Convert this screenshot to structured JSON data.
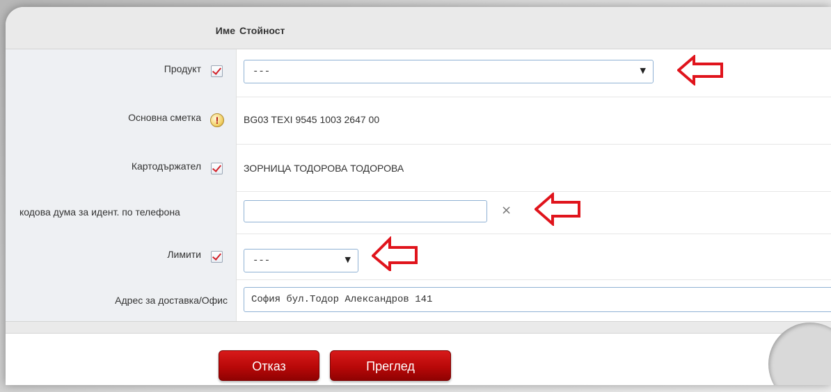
{
  "table": {
    "header_name": "Име",
    "header_value": "Стойност"
  },
  "rows": {
    "product": {
      "label": "Продукт",
      "selected": "---"
    },
    "main_account": {
      "label": "Основна сметка",
      "warn_glyph": "!",
      "value": "BG03 TEXI 9545 1003 2647 00"
    },
    "cardholder": {
      "label": "Картодържател",
      "value": "ЗОРНИЦА ТОДОРОВА ТОДОРОВА"
    },
    "code_word": {
      "label": "кодова дума за идент. по телефона",
      "value": "",
      "clear_glyph": "×"
    },
    "limits": {
      "label": "Лимити",
      "selected": "---"
    },
    "delivery": {
      "label": "Адрес за доставка/Офис",
      "value": "София бул.Тодор Александров 141"
    }
  },
  "buttons": {
    "cancel": "Отказ",
    "preview": "Преглед"
  },
  "icons": {
    "checkbox": "checkmark-icon",
    "warning": "exclamation-icon",
    "dropdown": "triangle-down-icon",
    "annotation": "left-arrow-icon"
  },
  "colors": {
    "accent_red": "#c40c0c",
    "annotation_red": "#e0141c",
    "header_bg": "#eaeaea",
    "label_bg": "#eef0f3",
    "input_border": "#8fb1d4"
  }
}
